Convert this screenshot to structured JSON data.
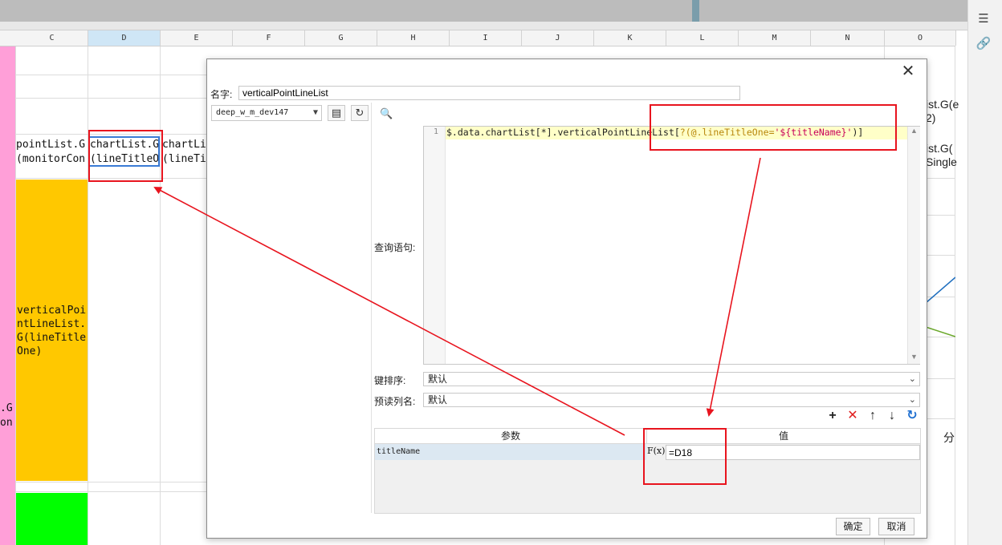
{
  "spreadsheet": {
    "columns": [
      "C",
      "D",
      "E",
      "F",
      "G",
      "H",
      "I",
      "J",
      "K",
      "L",
      "M",
      "N",
      "O"
    ],
    "selected_column": "D",
    "cells": {
      "c_row1": "pointList.G",
      "c_row2": "(monitorCon",
      "d_row1": "chartList.G",
      "d_row2": "(lineTitleO",
      "e_row1": "chartLi",
      "e_row2": "(lineTi",
      "b_edge1": ".G",
      "b_edge2": "on",
      "yellow_lines": [
        "verticalPoi",
        "ntLineList.",
        "G(lineTitle",
        "One)"
      ]
    },
    "right_peek": {
      "line1": "ist.G(e",
      "line2": "2)",
      "line3": "ist.G(",
      "line4": "Single",
      "fen": "分"
    }
  },
  "dialog": {
    "name_label": "名字:",
    "name_value": "verticalPointLineList",
    "datasource": "deep_w_m_dev147",
    "query_label": "查询语句:",
    "code_line_number": "1",
    "code_part1": "$.data.chartList[*].verticalPointLineList[",
    "code_part2": "?(@.lineTitleOne=",
    "code_part3": "'${titleName}'",
    "code_part4": ")]",
    "sort_label": "键排序:",
    "sort_value": "默认",
    "preread_label": "预读列名:",
    "preread_value": "默认",
    "params_header_name": "参数",
    "params_header_value": "值",
    "params": [
      {
        "name": "titleName",
        "value": "=D18"
      }
    ],
    "fx_label": "F(x)",
    "ok_label": "确定",
    "cancel_label": "取消"
  },
  "colors": {
    "annotation_red": "#e8141e",
    "yellow_cell": "#ffc800",
    "green_cell": "#00ff00",
    "pink_column": "#ff9fd8"
  }
}
